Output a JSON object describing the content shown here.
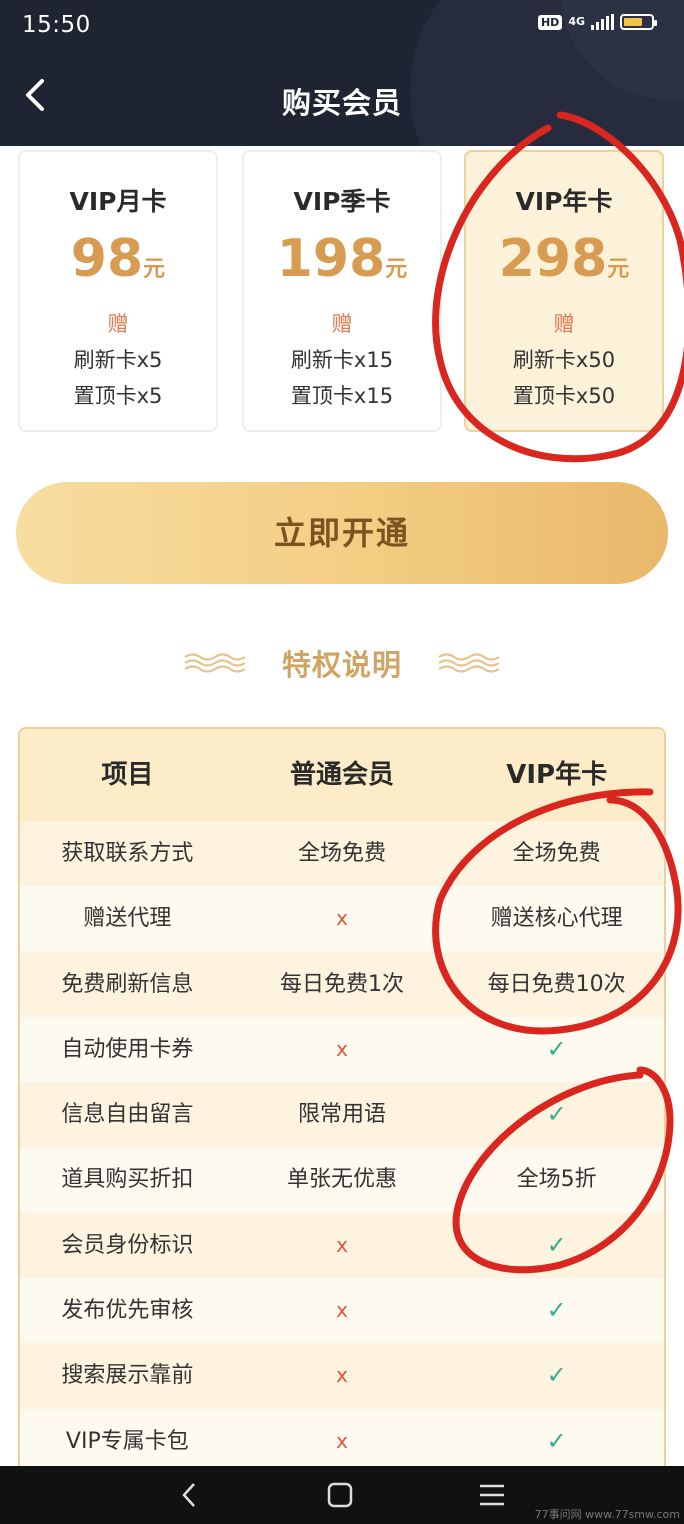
{
  "status_bar": {
    "time": "15:50",
    "hd": "HD",
    "network": "4G"
  },
  "header": {
    "title": "购买会员"
  },
  "plans": [
    {
      "name": "VIP月卡",
      "price": "98",
      "unit": "元",
      "gift_label": "赠",
      "line1": "刷新卡x5",
      "line2": "置顶卡x5",
      "selected": false
    },
    {
      "name": "VIP季卡",
      "price": "198",
      "unit": "元",
      "gift_label": "赠",
      "line1": "刷新卡x15",
      "line2": "置顶卡x15",
      "selected": false
    },
    {
      "name": "VIP年卡",
      "price": "298",
      "unit": "元",
      "gift_label": "赠",
      "line1": "刷新卡x50",
      "line2": "置顶卡x50",
      "selected": true
    }
  ],
  "open_button": "立即开通",
  "privileges_title": "特权说明",
  "table": {
    "headers": [
      "项目",
      "普通会员",
      "VIP年卡"
    ],
    "rows": [
      [
        "获取联系方式",
        "全场免费",
        "全场免费"
      ],
      [
        "赠送代理",
        "x",
        "赠送核心代理"
      ],
      [
        "免费刷新信息",
        "每日免费1次",
        "每日免费10次"
      ],
      [
        "自动使用卡券",
        "x",
        "✓"
      ],
      [
        "信息自由留言",
        "限常用语",
        "✓"
      ],
      [
        "道具购买折扣",
        "单张无优惠",
        "全场5折"
      ],
      [
        "会员身份标识",
        "x",
        "✓"
      ],
      [
        "发布优先审核",
        "x",
        "✓"
      ],
      [
        "搜索展示靠前",
        "x",
        "✓"
      ],
      [
        "VIP专属卡包",
        "x",
        "✓"
      ]
    ]
  },
  "watermark": "77事问网 www.77smw.com",
  "colors": {
    "header_bg": "#1f2433",
    "gold": "#d79b52",
    "gift": "#e07a55",
    "cross": "#e05540",
    "check": "#32b08e",
    "annotation": "#d9271f"
  }
}
